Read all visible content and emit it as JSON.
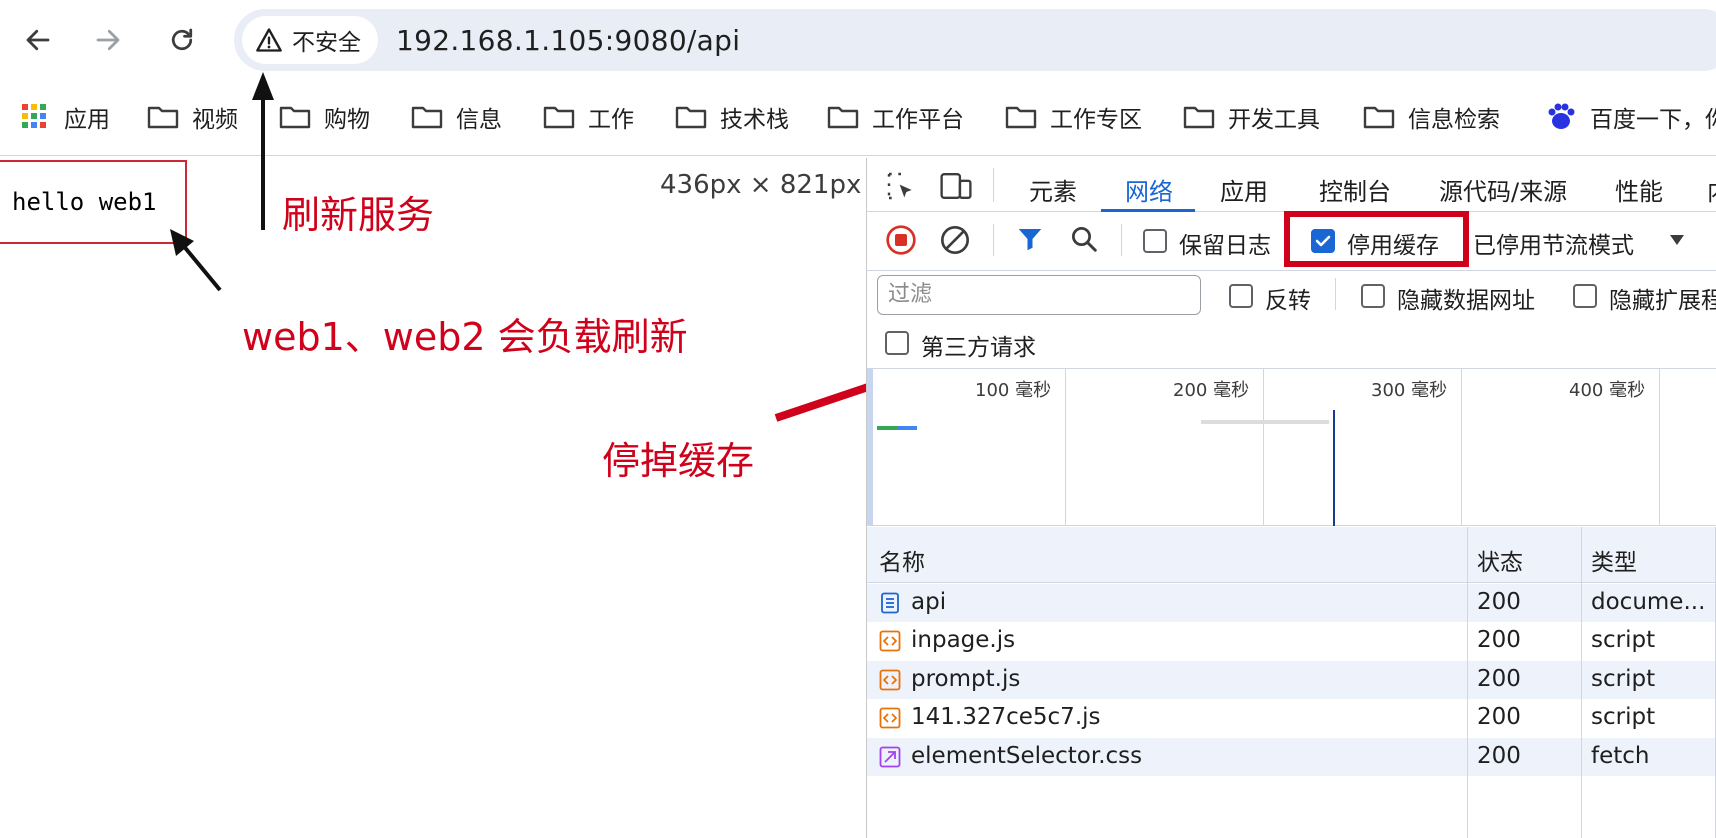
{
  "browser": {
    "security_label": "不安全",
    "url": "192.168.1.105:9080/api",
    "bookmarks": [
      {
        "label": "应用",
        "icon": "apps-grid-icon"
      },
      {
        "label": "视频",
        "icon": "folder-icon"
      },
      {
        "label": "购物",
        "icon": "folder-icon"
      },
      {
        "label": "信息",
        "icon": "folder-icon"
      },
      {
        "label": "工作",
        "icon": "folder-icon"
      },
      {
        "label": "技术栈",
        "icon": "folder-icon"
      },
      {
        "label": "工作平台",
        "icon": "folder-icon"
      },
      {
        "label": "工作专区",
        "icon": "folder-icon"
      },
      {
        "label": "开发工具",
        "icon": "folder-icon"
      },
      {
        "label": "信息检索",
        "icon": "folder-icon"
      },
      {
        "label": "百度一下，你",
        "icon": "baidu-paw-icon"
      }
    ]
  },
  "page": {
    "content_text": "hello web1",
    "viewport_size": "436px × 821px"
  },
  "annotations": {
    "refresh": "刷新服务",
    "load_balance": "web1、web2 会负载刷新",
    "disable_cache": "停掉缓存",
    "color": "#d0021b"
  },
  "devtools": {
    "tabs": [
      "元素",
      "网络",
      "应用",
      "控制台",
      "源代码/来源",
      "性能",
      "内"
    ],
    "active_tab": "网络",
    "preserve_log_label": "保留日志",
    "preserve_log_checked": false,
    "disable_cache_label": "停用缓存",
    "disable_cache_checked": true,
    "throttling": "已停用节流模式",
    "filter_placeholder": "过滤",
    "invert_label": "反转",
    "hide_data_urls_label": "隐藏数据网址",
    "hide_extensions_label": "隐藏扩展程",
    "third_party_label": "第三方请求",
    "timeline_ticks": [
      "100 毫秒",
      "200 毫秒",
      "300 毫秒",
      "400 毫秒"
    ],
    "columns": [
      "名称",
      "状态",
      "类型",
      ""
    ],
    "requests": [
      {
        "name": "api",
        "status": "200",
        "type": "docume...",
        "icon": "document-icon"
      },
      {
        "name": "inpage.js",
        "status": "200",
        "type": "script",
        "icon": "script-icon"
      },
      {
        "name": "prompt.js",
        "status": "200",
        "type": "script",
        "icon": "script-icon"
      },
      {
        "name": "141.327ce5c7.js",
        "status": "200",
        "type": "script",
        "icon": "script-icon"
      },
      {
        "name": "elementSelector.css",
        "status": "200",
        "type": "fetch",
        "icon": "fetch-icon"
      }
    ],
    "accent_color": "#1a66d2"
  }
}
